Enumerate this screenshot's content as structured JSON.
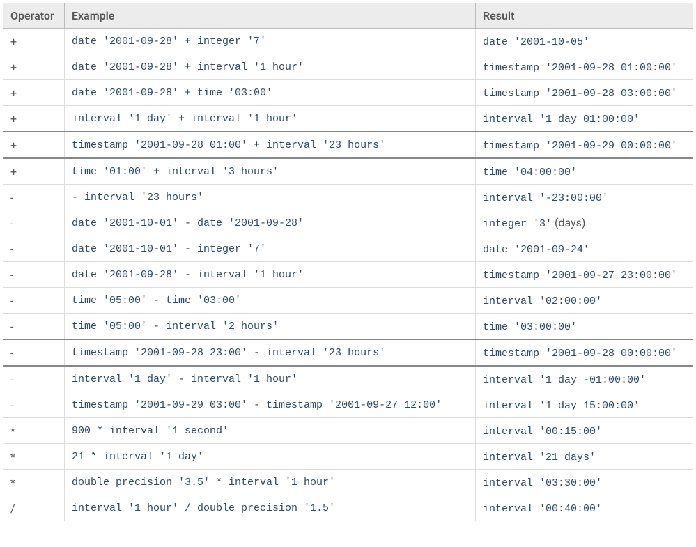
{
  "headers": {
    "operator": "Operator",
    "example": "Example",
    "result": "Result"
  },
  "rows": [
    {
      "operator": "+",
      "example": "date '2001-09-28' + integer '7'",
      "result": "date '2001-10-05'"
    },
    {
      "operator": "+",
      "example": "date '2001-09-28' + interval '1 hour'",
      "result": "timestamp '2001-09-28 01:00:00'"
    },
    {
      "operator": "+",
      "example": "date '2001-09-28' + time '03:00'",
      "result": "timestamp '2001-09-28 03:00:00'"
    },
    {
      "operator": "+",
      "example": "interval '1 day' + interval '1 hour'",
      "result": "interval '1 day 01:00:00'"
    },
    {
      "operator": "+",
      "example": "timestamp '2001-09-28 01:00' + interval '23 hours'",
      "result": "timestamp '2001-09-29 00:00:00'"
    },
    {
      "operator": "+",
      "example": "time '01:00' + interval '3 hours'",
      "result": "time '04:00:00'"
    },
    {
      "operator": "-",
      "example": "- interval '23 hours'",
      "result": "interval '-23:00:00'"
    },
    {
      "operator": "-",
      "example": "date '2001-10-01' - date '2001-09-28'",
      "result": "integer '3'",
      "result_suffix": " (days)"
    },
    {
      "operator": "-",
      "example": "date '2001-10-01' - integer '7'",
      "result": "date '2001-09-24'"
    },
    {
      "operator": "-",
      "example": "date '2001-09-28' - interval '1 hour'",
      "result": "timestamp '2001-09-27 23:00:00'"
    },
    {
      "operator": "-",
      "example": "time '05:00' - time '03:00'",
      "result": "interval '02:00:00'"
    },
    {
      "operator": "-",
      "example": "time '05:00' - interval '2 hours'",
      "result": "time '03:00:00'"
    },
    {
      "operator": "-",
      "example": "timestamp '2001-09-28 23:00' - interval '23 hours'",
      "result": "timestamp '2001-09-28 00:00:00'"
    },
    {
      "operator": "-",
      "example": "interval '1 day' - interval '1 hour'",
      "result": "interval '1 day -01:00:00'"
    },
    {
      "operator": "-",
      "example": "timestamp '2001-09-29 03:00' - timestamp '2001-09-27 12:00'",
      "result": "interval '1 day 15:00:00'"
    },
    {
      "operator": "*",
      "example": "900 * interval '1 second'",
      "result": "interval '00:15:00'"
    },
    {
      "operator": "*",
      "example": "21 * interval '1 day'",
      "result": "interval '21 days'"
    },
    {
      "operator": "*",
      "example": "double precision '3.5' * interval '1 hour'",
      "result": "interval '03:30:00'"
    },
    {
      "operator": "/",
      "example": "interval '1 hour' / double precision '1.5'",
      "result": "interval '00:40:00'"
    }
  ],
  "separators": {
    "above": [
      4,
      12
    ],
    "below": [
      4,
      12
    ]
  }
}
